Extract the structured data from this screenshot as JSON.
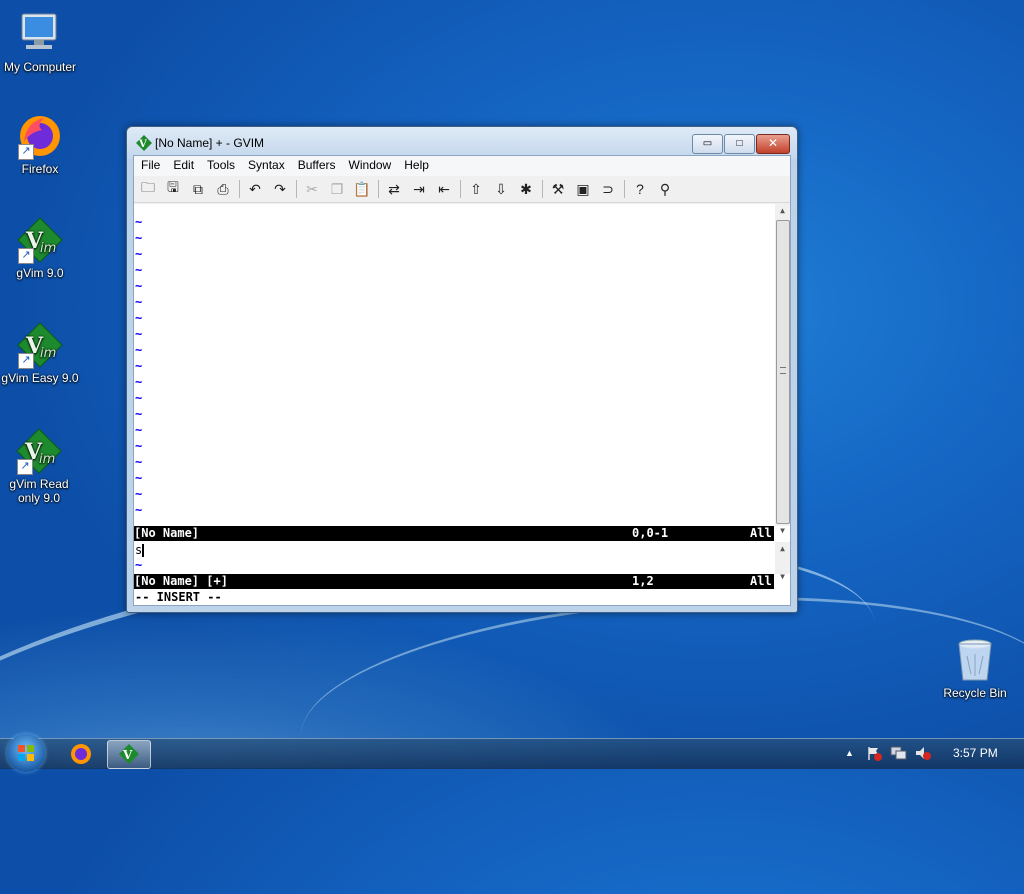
{
  "desktop": {
    "icons": [
      {
        "label": "My Computer"
      },
      {
        "label": "Firefox"
      },
      {
        "label": "gVim 9.0"
      },
      {
        "label": "gVim Easy 9.0"
      },
      {
        "label": "gVim Read only 9.0"
      },
      {
        "label": "Recycle Bin"
      }
    ]
  },
  "window": {
    "title": "[No Name] + - GVIM",
    "controls": {
      "minimize": "▭",
      "maximize": "□",
      "close": "✕"
    },
    "menu": [
      "File",
      "Edit",
      "Tools",
      "Syntax",
      "Buffers",
      "Window",
      "Help"
    ],
    "toolbar_icons": [
      "open-icon",
      "save-icon",
      "save-all-icon",
      "print-icon",
      "undo-icon",
      "redo-icon",
      "cut-icon",
      "copy-icon",
      "paste-icon",
      "replace-icon",
      "find-next-icon",
      "find-prev-icon",
      "load-session-icon",
      "save-session-icon",
      "run-script-icon",
      "make-icon",
      "shell-icon",
      "ctags-icon",
      "help-icon",
      "find-help-icon"
    ],
    "tilde": "~",
    "top_status": {
      "name": "[No Name]",
      "position": "0,0-1",
      "scroll": "All"
    },
    "bottom_buffer_text": "s",
    "bottom_status": {
      "name": "[No Name] [+]",
      "position": "1,2",
      "scroll": "All"
    },
    "mode": "-- INSERT --"
  },
  "taskbar": {
    "clock": "3:57 PM",
    "tray_expand": "▲"
  }
}
